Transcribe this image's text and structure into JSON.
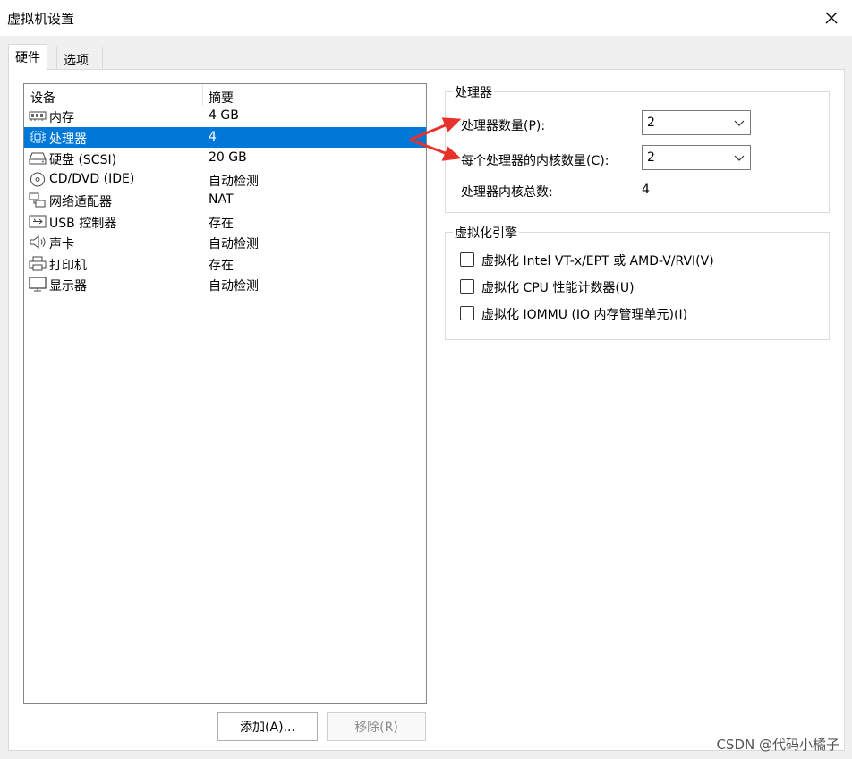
{
  "window": {
    "title": "虚拟机设置",
    "close_label": "✕"
  },
  "tabs": [
    {
      "label": "硬件"
    },
    {
      "label": "选项"
    }
  ],
  "device_list": {
    "headers": {
      "device": "设备",
      "summary": "摘要"
    },
    "rows": [
      {
        "icon": "memory-icon",
        "name": "内存",
        "summary": "4 GB"
      },
      {
        "icon": "processor-icon",
        "name": "处理器",
        "summary": "4"
      },
      {
        "icon": "hard-disk-icon",
        "name": "硬盘 (SCSI)",
        "summary": "20 GB"
      },
      {
        "icon": "cd-dvd-icon",
        "name": "CD/DVD (IDE)",
        "summary": "自动检测"
      },
      {
        "icon": "network-adapter-icon",
        "name": "网络适配器",
        "summary": "NAT"
      },
      {
        "icon": "usb-icon",
        "name": "USB 控制器",
        "summary": "存在"
      },
      {
        "icon": "sound-card-icon",
        "name": "声卡",
        "summary": "自动检测"
      },
      {
        "icon": "printer-icon",
        "name": "打印机",
        "summary": "存在"
      },
      {
        "icon": "display-icon",
        "name": "显示器",
        "summary": "自动检测"
      }
    ],
    "selected_index": 1
  },
  "buttons": {
    "add": "添加(A)...",
    "remove": "移除(R)"
  },
  "processor_group": {
    "title": "处理器",
    "processor_count_label": "处理器数量(P):",
    "processor_count_value": "2",
    "cores_per_processor_label": "每个处理器的内核数量(C):",
    "cores_per_processor_value": "2",
    "total_cores_label": "处理器内核总数:",
    "total_cores_value": "4"
  },
  "virtualization_group": {
    "title": "虚拟化引擎",
    "options": [
      {
        "label": "虚拟化 Intel VT-x/EPT 或 AMD-V/RVI(V)",
        "checked": false
      },
      {
        "label": "虚拟化 CPU 性能计数器(U)",
        "checked": false
      },
      {
        "label": "虚拟化 IOMMU (IO 内存管理单元)(I)",
        "checked": false
      }
    ]
  },
  "watermark": "CSDN @代码小橘子",
  "colors": {
    "selection": "#0078d7",
    "annotation_arrow": "#e8312a"
  }
}
